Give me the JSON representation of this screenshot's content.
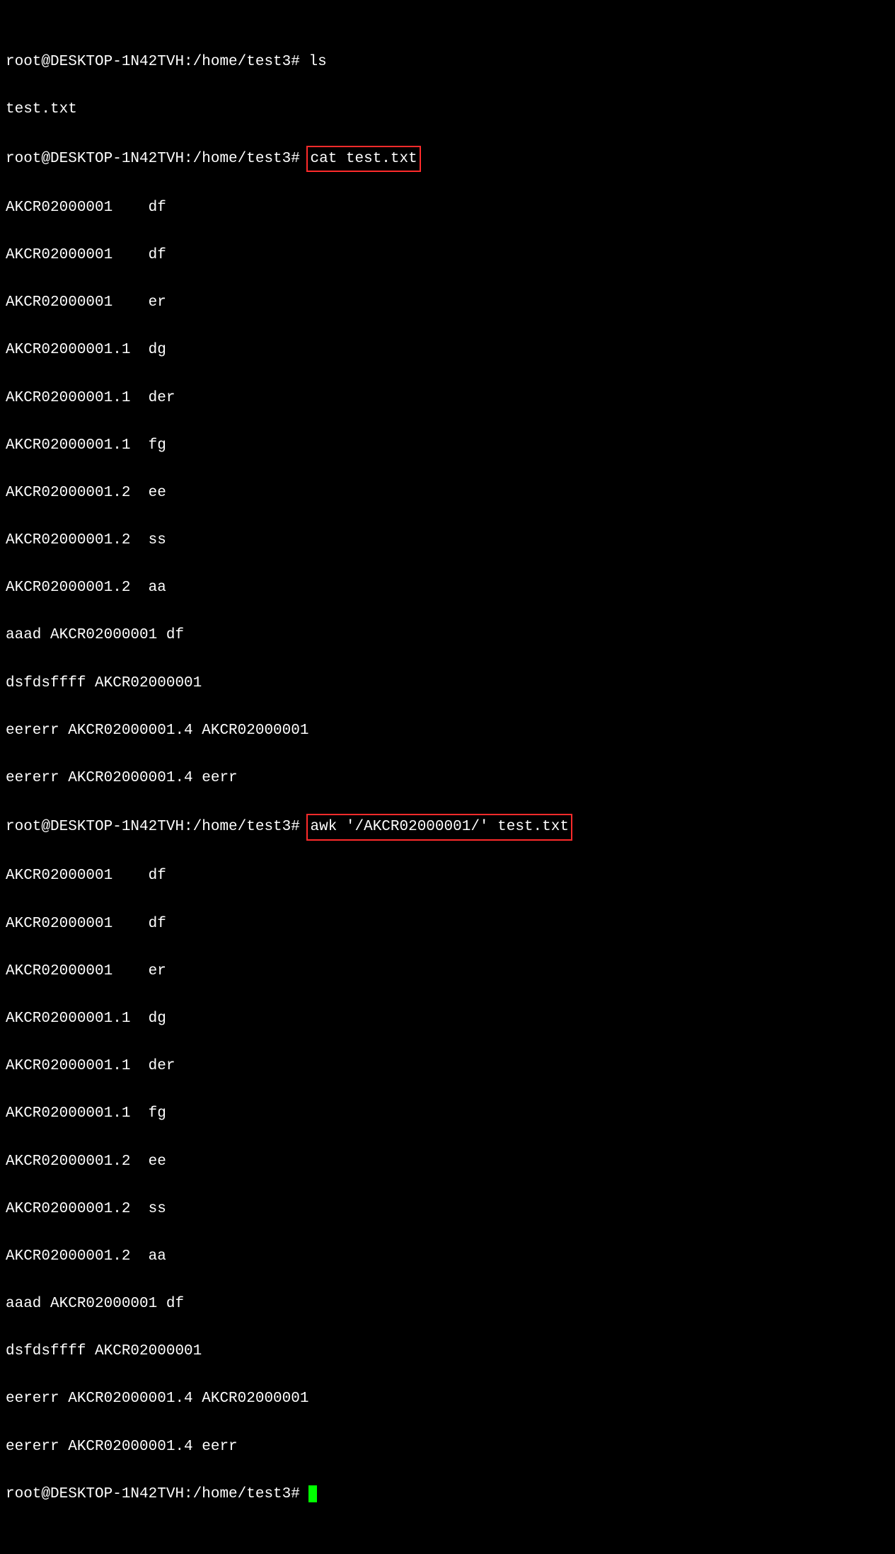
{
  "prompt": "root@DESKTOP-1N42TVH:/home/test3# ",
  "cmd_ls": "ls",
  "ls_output": "test.txt",
  "cmd_cat": "cat test.txt",
  "cat_output": [
    "AKCR02000001    df",
    "AKCR02000001    df",
    "AKCR02000001    er",
    "AKCR02000001.1  dg",
    "AKCR02000001.1  der",
    "AKCR02000001.1  fg",
    "AKCR02000001.2  ee",
    "AKCR02000001.2  ss",
    "AKCR02000001.2  aa",
    "aaad AKCR02000001 df",
    "dsfdsffff AKCR02000001",
    "eererr AKCR02000001.4 AKCR02000001",
    "eererr AKCR02000001.4 eerr"
  ],
  "cmd_awk": "awk '/AKCR02000001/' test.txt",
  "awk_output": [
    "AKCR02000001    df",
    "AKCR02000001    df",
    "AKCR02000001    er",
    "AKCR02000001.1  dg",
    "AKCR02000001.1  der",
    "AKCR02000001.1  fg",
    "AKCR02000001.2  ee",
    "AKCR02000001.2  ss",
    "AKCR02000001.2  aa",
    "aaad AKCR02000001 df",
    "dsfdsffff AKCR02000001",
    "eererr AKCR02000001.4 AKCR02000001",
    "eererr AKCR02000001.4 eerr"
  ]
}
